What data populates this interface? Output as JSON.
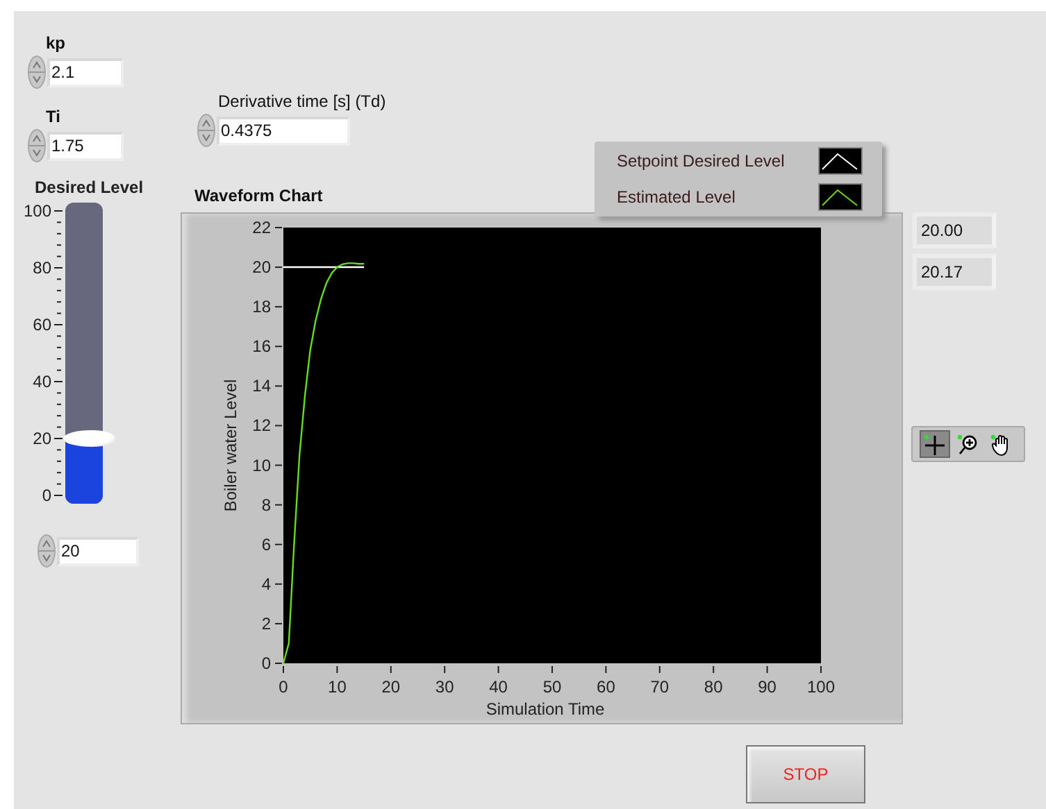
{
  "controls": [
    {
      "label": "kp",
      "value": "2.1",
      "kind": "tuning"
    },
    {
      "label": "Ti",
      "value": "1.75",
      "kind": "tuning"
    },
    {
      "label": "Derivative time [s] (Td)",
      "value": "0.4375",
      "kind": "derivative"
    }
  ],
  "slide": {
    "label": "Desired Level",
    "scale": [
      "100",
      "80",
      "60",
      "40",
      "20",
      "0"
    ],
    "level": 0.2,
    "value": "20"
  },
  "chart": {
    "title": "Waveform Chart",
    "chart_data": {
      "type": "line",
      "xlabel": "Simulation Time",
      "ylabel": "Boiler water Level",
      "x": [
        0,
        1,
        2,
        3,
        4,
        5,
        6,
        7,
        8,
        9,
        10,
        11,
        12,
        13,
        14,
        15
      ],
      "series": [
        {
          "name": "Setpoint Desired Level",
          "color": "#ffffff",
          "values": [
            20,
            20,
            20,
            20,
            20,
            20,
            20,
            20,
            20,
            20,
            20,
            20,
            20,
            20,
            20,
            20
          ]
        },
        {
          "name": "Estimated Level",
          "color": "#66dd22",
          "values": [
            0,
            1,
            6,
            10.5,
            13.5,
            15.8,
            17.3,
            18.4,
            19.2,
            19.7,
            20.0,
            20.15,
            20.2,
            20.2,
            20.17,
            20.17
          ]
        }
      ],
      "xlim": [
        0,
        100
      ],
      "ylim": [
        0,
        22
      ],
      "xticks": [
        0,
        10,
        20,
        30,
        40,
        50,
        60,
        70,
        80,
        90,
        100
      ],
      "yticks": [
        0,
        2,
        4,
        6,
        8,
        10,
        12,
        14,
        16,
        18,
        20,
        22
      ]
    }
  },
  "digital_displays": [
    "20.00",
    "20.17"
  ],
  "graph_palette": [
    {
      "kind": "cursor",
      "selected": true
    },
    {
      "kind": "zoom",
      "selected": false
    },
    {
      "kind": "pan",
      "selected": false
    }
  ],
  "stop_button": {
    "label": "STOP"
  }
}
